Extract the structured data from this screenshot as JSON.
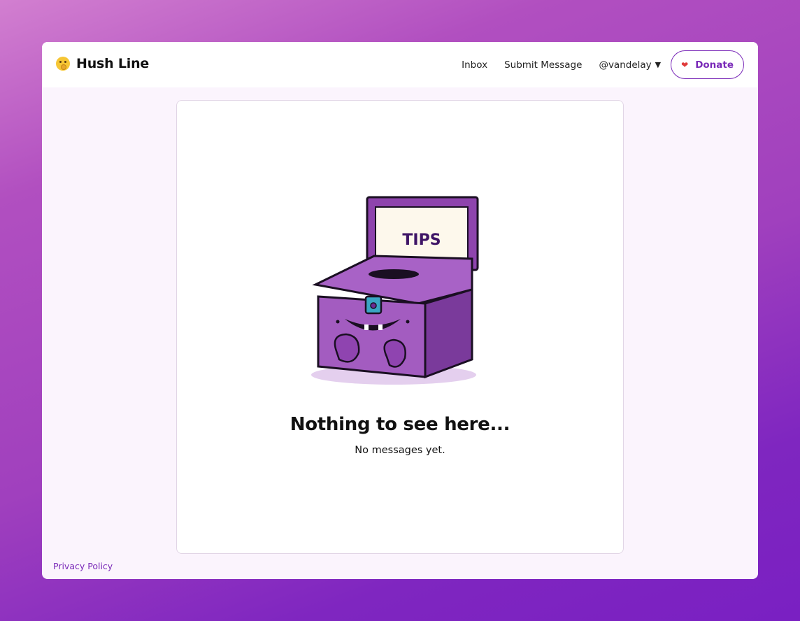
{
  "app": {
    "title": "Hush Line",
    "emoji_icon": "shushing-face-icon"
  },
  "nav": {
    "inbox_label": "Inbox",
    "submit_label": "Submit Message",
    "user_label": "@vandelay",
    "user_caret": "▼",
    "donate_label": "Donate",
    "donate_icon": "heart-icon"
  },
  "empty_state": {
    "illustration_text": "TIPS",
    "title": "Nothing to see here...",
    "subtitle": "No messages yet."
  },
  "footer": {
    "privacy_label": "Privacy Policy"
  },
  "colors": {
    "accent": "#7a2ab8",
    "heart": "#e03a3a",
    "window_bg": "#fbf4fd",
    "box_purple": "#9b59b6"
  }
}
